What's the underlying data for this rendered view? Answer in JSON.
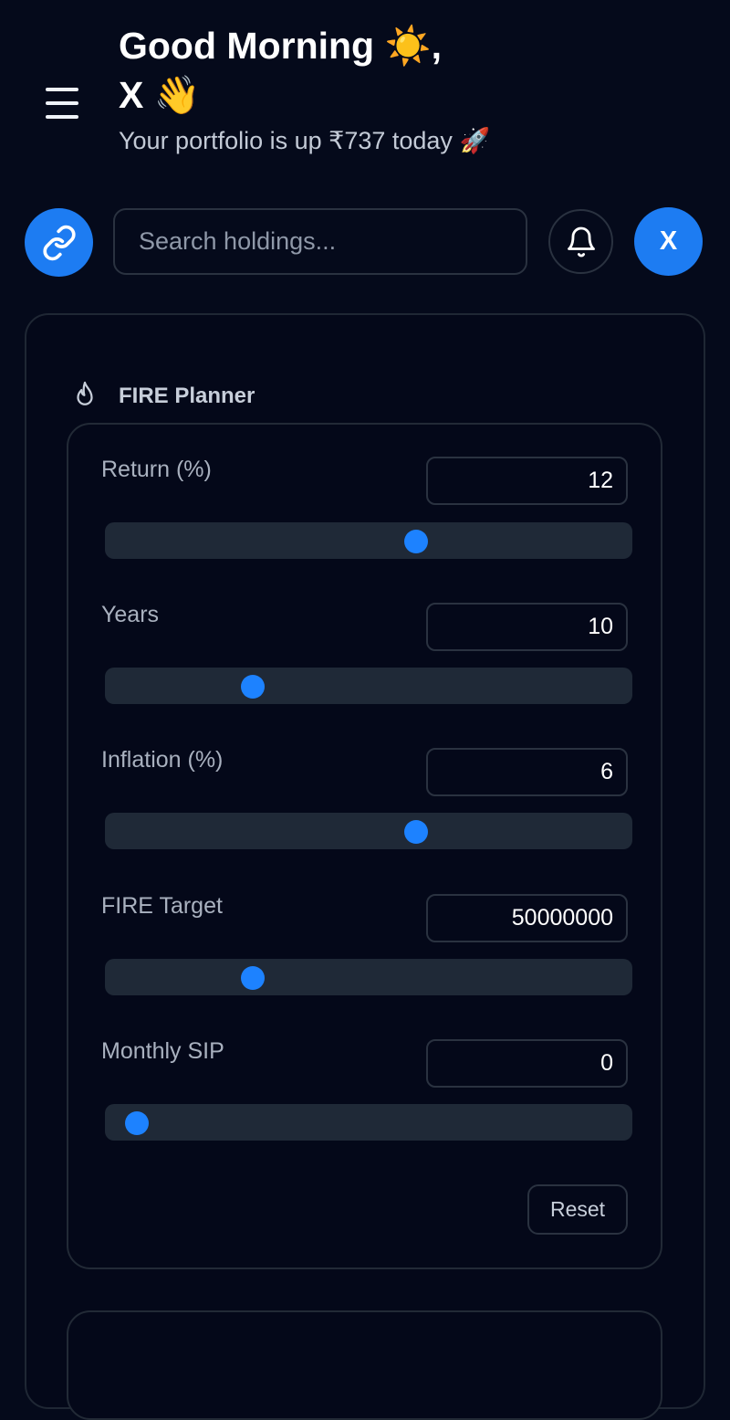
{
  "header": {
    "greeting": "Good Morning",
    "sun_emoji": "☀️",
    "comma": ",",
    "user_name": "X",
    "wave_emoji": "👋",
    "portfolio_text": "Your portfolio is up ₹737 today",
    "rocket_emoji": "🚀"
  },
  "toolbar": {
    "search_placeholder": "Search holdings...",
    "avatar_initial": "X",
    "icons": [
      "menu-icon",
      "link-icon",
      "bell-icon"
    ]
  },
  "fire_planner": {
    "title": "FIRE Planner",
    "icon": "flame-icon",
    "fields": [
      {
        "label": "Return (%)",
        "value": "12",
        "slider_fraction": 0.59
      },
      {
        "label": "Years",
        "value": "10",
        "slider_fraction": 0.28
      },
      {
        "label": "Inflation (%)",
        "value": "6",
        "slider_fraction": 0.59
      },
      {
        "label": "FIRE Target",
        "value": "50000000",
        "slider_fraction": 0.28
      },
      {
        "label": "Monthly SIP",
        "value": "0",
        "slider_fraction": 0.06
      }
    ],
    "reset_label": "Reset"
  },
  "colors": {
    "background": "#050a1b",
    "accent": "#1d7cf2",
    "border": "#2a3240"
  }
}
